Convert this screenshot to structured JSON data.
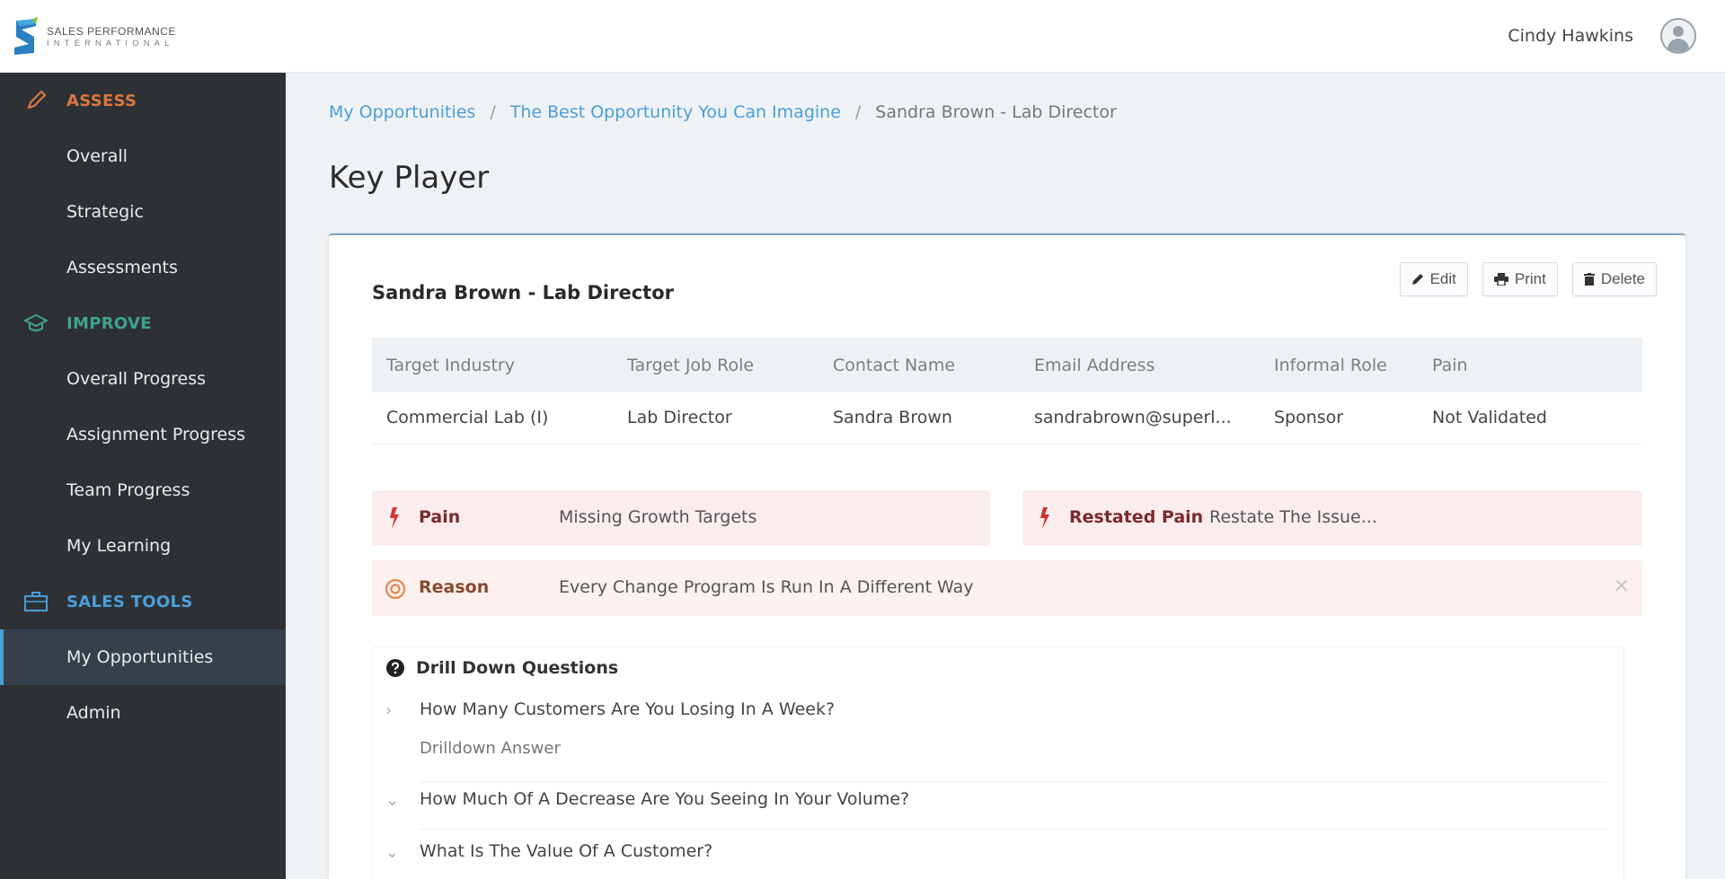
{
  "brand": {
    "line1": "SALES PERFORMANCE",
    "line2": "INTERNATIONAL",
    "colors": {
      "blue": "#2a7fc1",
      "light_blue": "#4aa8e0",
      "green": "#8dc63f"
    }
  },
  "header": {
    "user_name": "Cindy Hawkins",
    "avatar_icon": "user-circle-icon"
  },
  "sidebar": {
    "sections": [
      {
        "label": "ASSESS",
        "icon": "pencil-icon",
        "color": "#d9773c",
        "items": [
          {
            "label": "Overall",
            "active": false
          },
          {
            "label": "Strategic",
            "active": false
          },
          {
            "label": "Assessments",
            "active": false
          }
        ]
      },
      {
        "label": "IMPROVE",
        "icon": "graduation-cap-icon",
        "color": "#3fa38a",
        "items": [
          {
            "label": "Overall Progress",
            "active": false
          },
          {
            "label": "Assignment Progress",
            "active": false
          },
          {
            "label": "Team Progress",
            "active": false
          },
          {
            "label": "My Learning",
            "active": false
          }
        ]
      },
      {
        "label": "SALES TOOLS",
        "icon": "briefcase-icon",
        "color": "#4a9fd8",
        "items": [
          {
            "label": "My Opportunities",
            "active": true
          },
          {
            "label": "Admin",
            "active": false
          }
        ]
      }
    ]
  },
  "breadcrumb": {
    "items": [
      {
        "label": "My Opportunities",
        "link": true
      },
      {
        "label": "The Best Opportunity You Can Imagine",
        "link": true
      },
      {
        "label": "Sandra Brown - Lab Director",
        "link": false
      }
    ],
    "separator": "/"
  },
  "page": {
    "title": "Key Player"
  },
  "card": {
    "title": "Sandra Brown - Lab Director",
    "actions": {
      "edit": "Edit",
      "print": "Print",
      "delete": "Delete"
    },
    "table": {
      "headers": [
        "Target Industry",
        "Target Job Role",
        "Contact Name",
        "Email Address",
        "Informal Role",
        "Pain"
      ],
      "row": [
        "Commercial Lab (I)",
        "Lab Director",
        "Sandra Brown",
        "sandrabrown@superl...",
        "Sponsor",
        "Not Validated"
      ]
    },
    "pain": {
      "label": "Pain",
      "value": "Missing Growth Targets"
    },
    "restated_pain": {
      "label": "Restated Pain",
      "value": "Restate The Issue..."
    },
    "reason": {
      "label": "Reason",
      "value": "Every Change Program Is Run In A Different Way",
      "close": "×"
    },
    "drill_down": {
      "title": "Drill Down Questions",
      "questions": [
        {
          "text": "How Many Customers Are You Losing In A Week?",
          "expanded": true,
          "answer_placeholder": "Drilldown Answer",
          "answer": ""
        },
        {
          "text": "How Much Of A Decrease Are You Seeing In Your Volume?",
          "expanded": false
        },
        {
          "text": "What Is The Value Of A Customer?",
          "expanded": false
        }
      ]
    }
  },
  "colors": {
    "sidebar_bg": "#2d3136",
    "active_item_bg": "#35404b",
    "link": "#4a9fd8",
    "pain_bg": "#fbecee",
    "pain_label": "#7a2a2a",
    "pain_icon": "#d0342c",
    "reason_bg": "#fcf1ee",
    "reason_icon": "#e8864e"
  }
}
